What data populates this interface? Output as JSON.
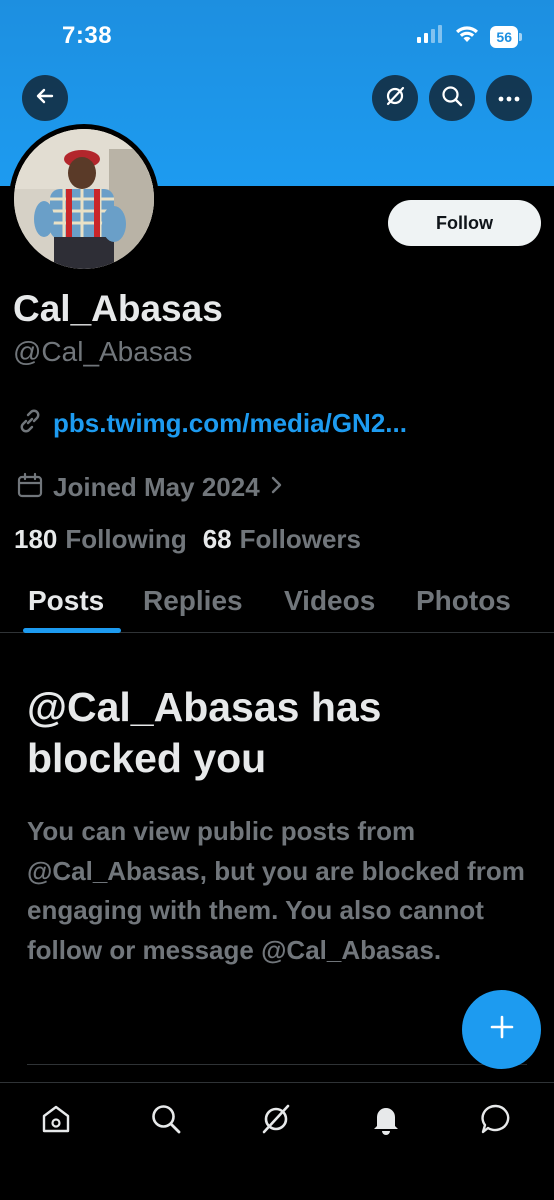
{
  "status_bar": {
    "time": "7:38",
    "battery": "56"
  },
  "header": {
    "follow_label": "Follow"
  },
  "profile": {
    "display_name": "Cal_Abasas",
    "handle": "@Cal_Abasas",
    "link": "pbs.twimg.com/media/GN2...",
    "joined": "Joined May 2024",
    "following_count": "180",
    "following_label": "Following",
    "followers_count": "68",
    "followers_label": "Followers"
  },
  "tabs": [
    {
      "label": "Posts",
      "active": true
    },
    {
      "label": "Replies",
      "active": false
    },
    {
      "label": "Videos",
      "active": false
    },
    {
      "label": "Photos",
      "active": false
    }
  ],
  "blocked": {
    "title": "@Cal_Abasas has blocked you",
    "body": "You can view public posts from @Cal_Abasas, but you are blocked from engaging with them. You also cannot follow or message @Cal_Abasas."
  },
  "colors": {
    "accent": "#1d9bf0",
    "background": "#000000",
    "muted": "#71767b",
    "text": "#e7e9ea"
  },
  "icons": {
    "header": [
      "back-arrow-icon",
      "grok-icon",
      "search-icon",
      "more-icon"
    ],
    "nav": [
      "home-icon",
      "search-icon",
      "grok-icon",
      "notifications-icon",
      "messages-icon"
    ],
    "fab": "plus-icon"
  }
}
